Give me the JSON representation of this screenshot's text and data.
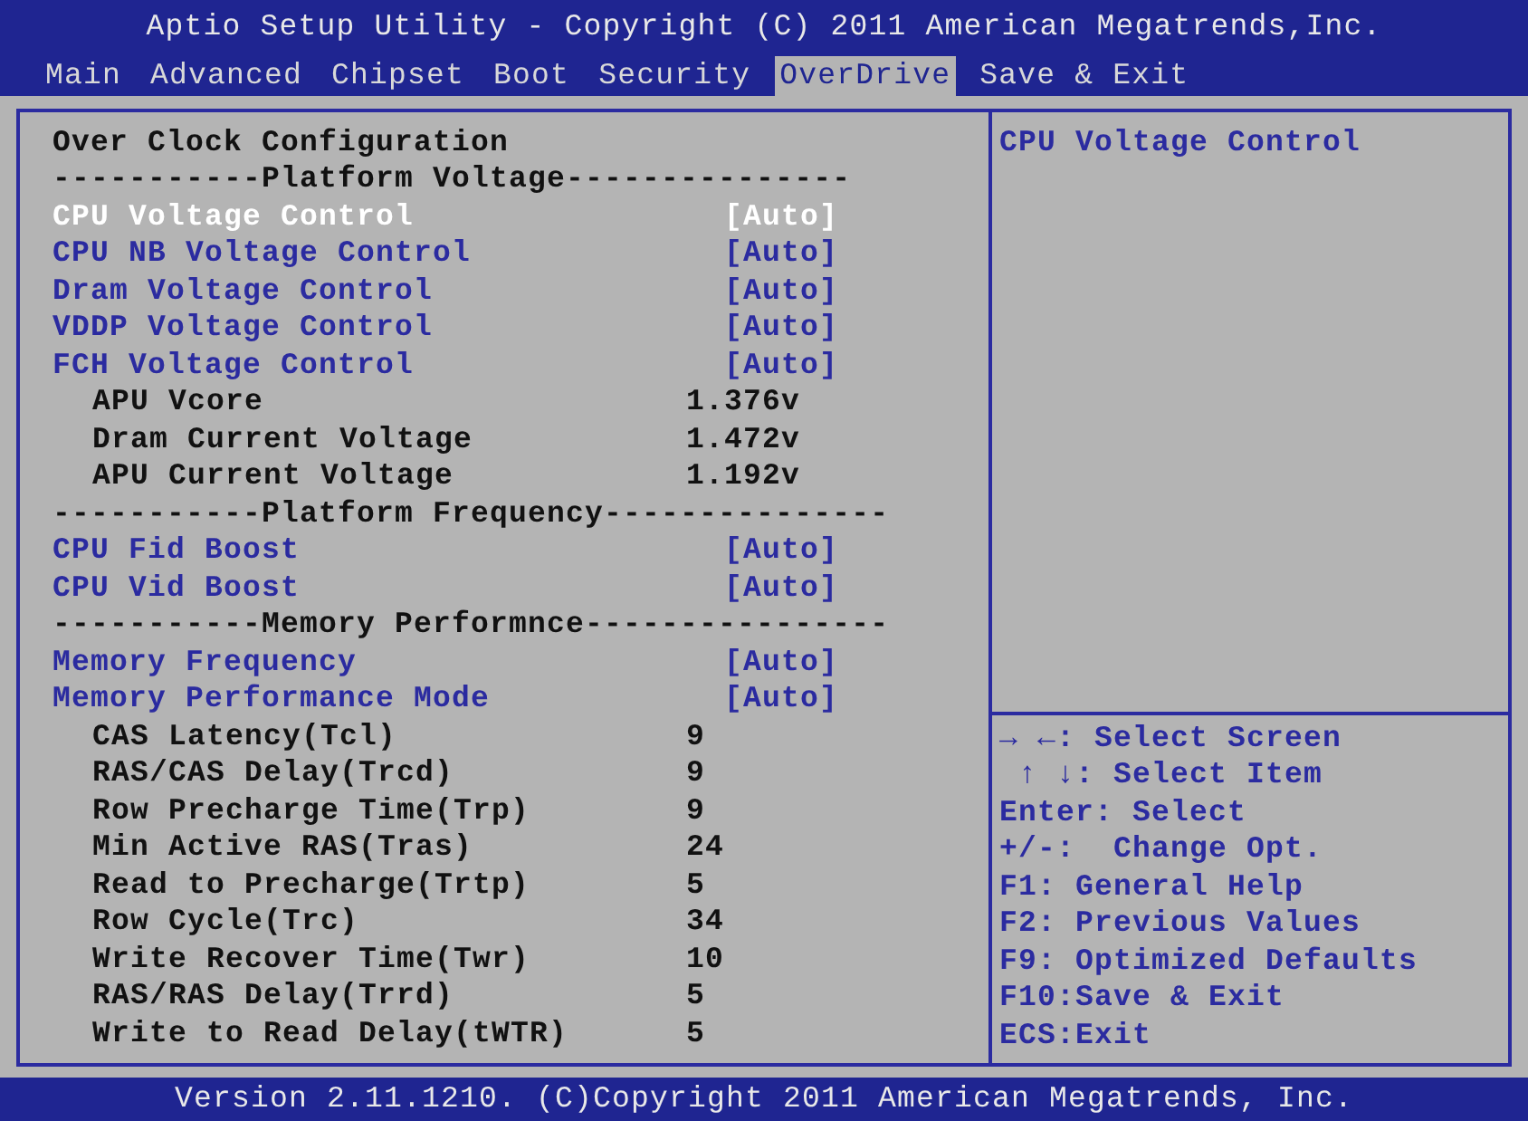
{
  "window": {
    "title": "Aptio Setup Utility - Copyright (C) 2011 American Megatrends,Inc."
  },
  "tabs": [
    {
      "label": "Main",
      "selected": false
    },
    {
      "label": "Advanced",
      "selected": false
    },
    {
      "label": "Chipset",
      "selected": false
    },
    {
      "label": "Boot",
      "selected": false
    },
    {
      "label": "Security",
      "selected": false
    },
    {
      "label": "OverDrive",
      "selected": true
    },
    {
      "label": "Save & Exit",
      "selected": false
    }
  ],
  "settings": [
    {
      "kind": "header",
      "label": "Over Clock Configuration"
    },
    {
      "kind": "separator",
      "label": "-----------Platform Voltage---------------"
    },
    {
      "kind": "setting",
      "label": "CPU Voltage Control",
      "value": "[Auto]",
      "selected": true
    },
    {
      "kind": "setting",
      "label": "CPU NB Voltage Control",
      "value": "[Auto]",
      "selected": false
    },
    {
      "kind": "setting",
      "label": "Dram Voltage Control",
      "value": "[Auto]",
      "selected": false
    },
    {
      "kind": "setting",
      "label": "VDDP Voltage Control",
      "value": "[Auto]",
      "selected": false
    },
    {
      "kind": "setting",
      "label": "FCH Voltage Control",
      "value": "[Auto]",
      "selected": false
    },
    {
      "kind": "info",
      "label": "APU Vcore",
      "value": "1.376v"
    },
    {
      "kind": "info",
      "label": "Dram Current Voltage",
      "value": "1.472v"
    },
    {
      "kind": "info",
      "label": "APU Current Voltage",
      "value": "1.192v"
    },
    {
      "kind": "separator",
      "label": "-----------Platform Frequency---------------"
    },
    {
      "kind": "setting",
      "label": "CPU Fid Boost",
      "value": "[Auto]",
      "selected": false
    },
    {
      "kind": "setting",
      "label": "CPU Vid Boost",
      "value": "[Auto]",
      "selected": false
    },
    {
      "kind": "separator",
      "label": "-----------Memory Performnce----------------"
    },
    {
      "kind": "setting",
      "label": "Memory Frequency",
      "value": "[Auto]",
      "selected": false
    },
    {
      "kind": "setting",
      "label": "Memory Performance Mode",
      "value": "[Auto]",
      "selected": false
    },
    {
      "kind": "info",
      "label": "CAS Latency(Tcl)",
      "value": "9"
    },
    {
      "kind": "info",
      "label": "RAS/CAS Delay(Trcd)",
      "value": "9"
    },
    {
      "kind": "info",
      "label": "Row Precharge Time(Trp)",
      "value": "9"
    },
    {
      "kind": "info",
      "label": "Min Active RAS(Tras)",
      "value": "24"
    },
    {
      "kind": "info",
      "label": "Read to Precharge(Trtp)",
      "value": "5"
    },
    {
      "kind": "info",
      "label": "Row Cycle(Trc)",
      "value": "34"
    },
    {
      "kind": "info",
      "label": "Write Recover Time(Twr)",
      "value": "10"
    },
    {
      "kind": "info",
      "label": "RAS/RAS Delay(Trrd)",
      "value": "5"
    },
    {
      "kind": "info",
      "label": "Write to Read Delay(tWTR)",
      "value": "5"
    }
  ],
  "help": {
    "text": "CPU Voltage Control"
  },
  "keys": [
    "→ ←: Select Screen",
    " ↑ ↓: Select Item",
    "Enter: Select",
    "+/-:  Change Opt.",
    "F1: General Help",
    "F2: Previous Values",
    "F9: Optimized Defaults",
    "F10:Save & Exit",
    "ECS:Exit"
  ],
  "status_bar": {
    "text": "Version 2.11.1210. (C)Copyright 2011 American Megatrends, Inc."
  }
}
